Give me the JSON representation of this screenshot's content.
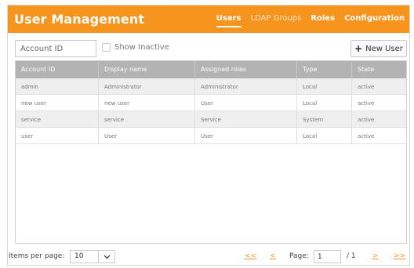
{
  "header": {
    "title": "User Management",
    "nav": [
      {
        "label": "Users",
        "active": true
      },
      {
        "label": "LDAP Groups",
        "active": false
      },
      {
        "label": "Roles",
        "active": false
      },
      {
        "label": "Configuration",
        "active": false
      }
    ]
  },
  "toolbar": {
    "search_placeholder": "Account ID",
    "search_value": "",
    "show_inactive_label": "Show Inactive",
    "show_inactive_checked": false,
    "new_user_icon": "plus-icon",
    "new_user_label": "New User"
  },
  "table": {
    "columns": [
      "Account ID",
      "Display name",
      "Assigned roles",
      "Type",
      "State"
    ],
    "rows": [
      [
        "admin",
        "Administrator",
        "Administrator",
        "Local",
        "active"
      ],
      [
        "new user",
        "new user",
        "User",
        "Local",
        "active"
      ],
      [
        "service",
        "service",
        "Service",
        "System",
        "active"
      ],
      [
        "user",
        "User",
        "User",
        "Local",
        "active"
      ]
    ]
  },
  "pagination": {
    "items_per_page_label": "Items per page:",
    "items_per_page_value": "10",
    "first": "<<",
    "prev": "<",
    "page_label": "Page:",
    "page_value": "1",
    "total": "/ 1",
    "next": ">",
    "last": ">>"
  },
  "colors": {
    "accent": "#f7941d",
    "header_text": "#ffffff",
    "table_header": "#b3b3b3"
  }
}
